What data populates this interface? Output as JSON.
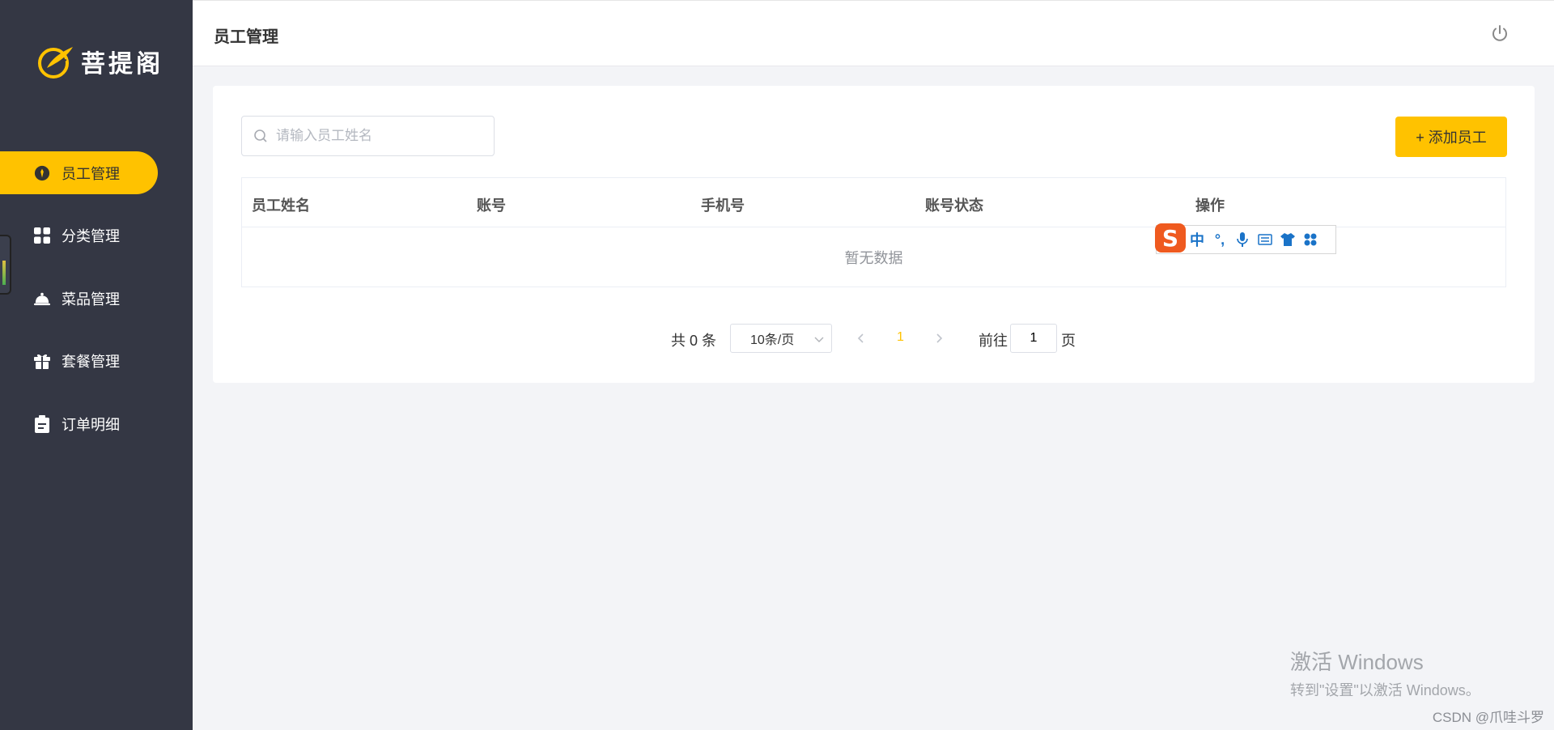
{
  "brand": {
    "name": "菩提阁"
  },
  "sidebar": {
    "items": [
      {
        "label": "员工管理",
        "icon": "employee-icon",
        "active": true
      },
      {
        "label": "分类管理",
        "icon": "grid-icon",
        "active": false
      },
      {
        "label": "菜品管理",
        "icon": "dish-bell-icon",
        "active": false
      },
      {
        "label": "套餐管理",
        "icon": "gift-icon",
        "active": false
      },
      {
        "label": "订单明细",
        "icon": "clipboard-icon",
        "active": false
      }
    ]
  },
  "header": {
    "title": "员工管理",
    "logout_icon": "power-icon"
  },
  "toolbar": {
    "search_placeholder": "请输入员工姓名",
    "search_value": "",
    "add_label": "+ 添加员工"
  },
  "table": {
    "columns": [
      "员工姓名",
      "账号",
      "手机号",
      "账号状态",
      "操作"
    ],
    "rows": [],
    "empty_text": "暂无数据"
  },
  "pagination": {
    "total_text": "共 0 条",
    "page_size": "10条/页",
    "current_page": "1",
    "goto_label": "前往",
    "goto_value": "1",
    "page_suffix": "页"
  },
  "ime": {
    "lang": "中",
    "punct": "°,"
  },
  "watermark": {
    "line1": "激活 Windows",
    "line2": "转到\"设置\"以激活 Windows。",
    "csdn": "CSDN @爪哇斗罗"
  },
  "colors": {
    "accent": "#ffc200",
    "sidebar": "#343744",
    "background": "#f3f4f7"
  }
}
